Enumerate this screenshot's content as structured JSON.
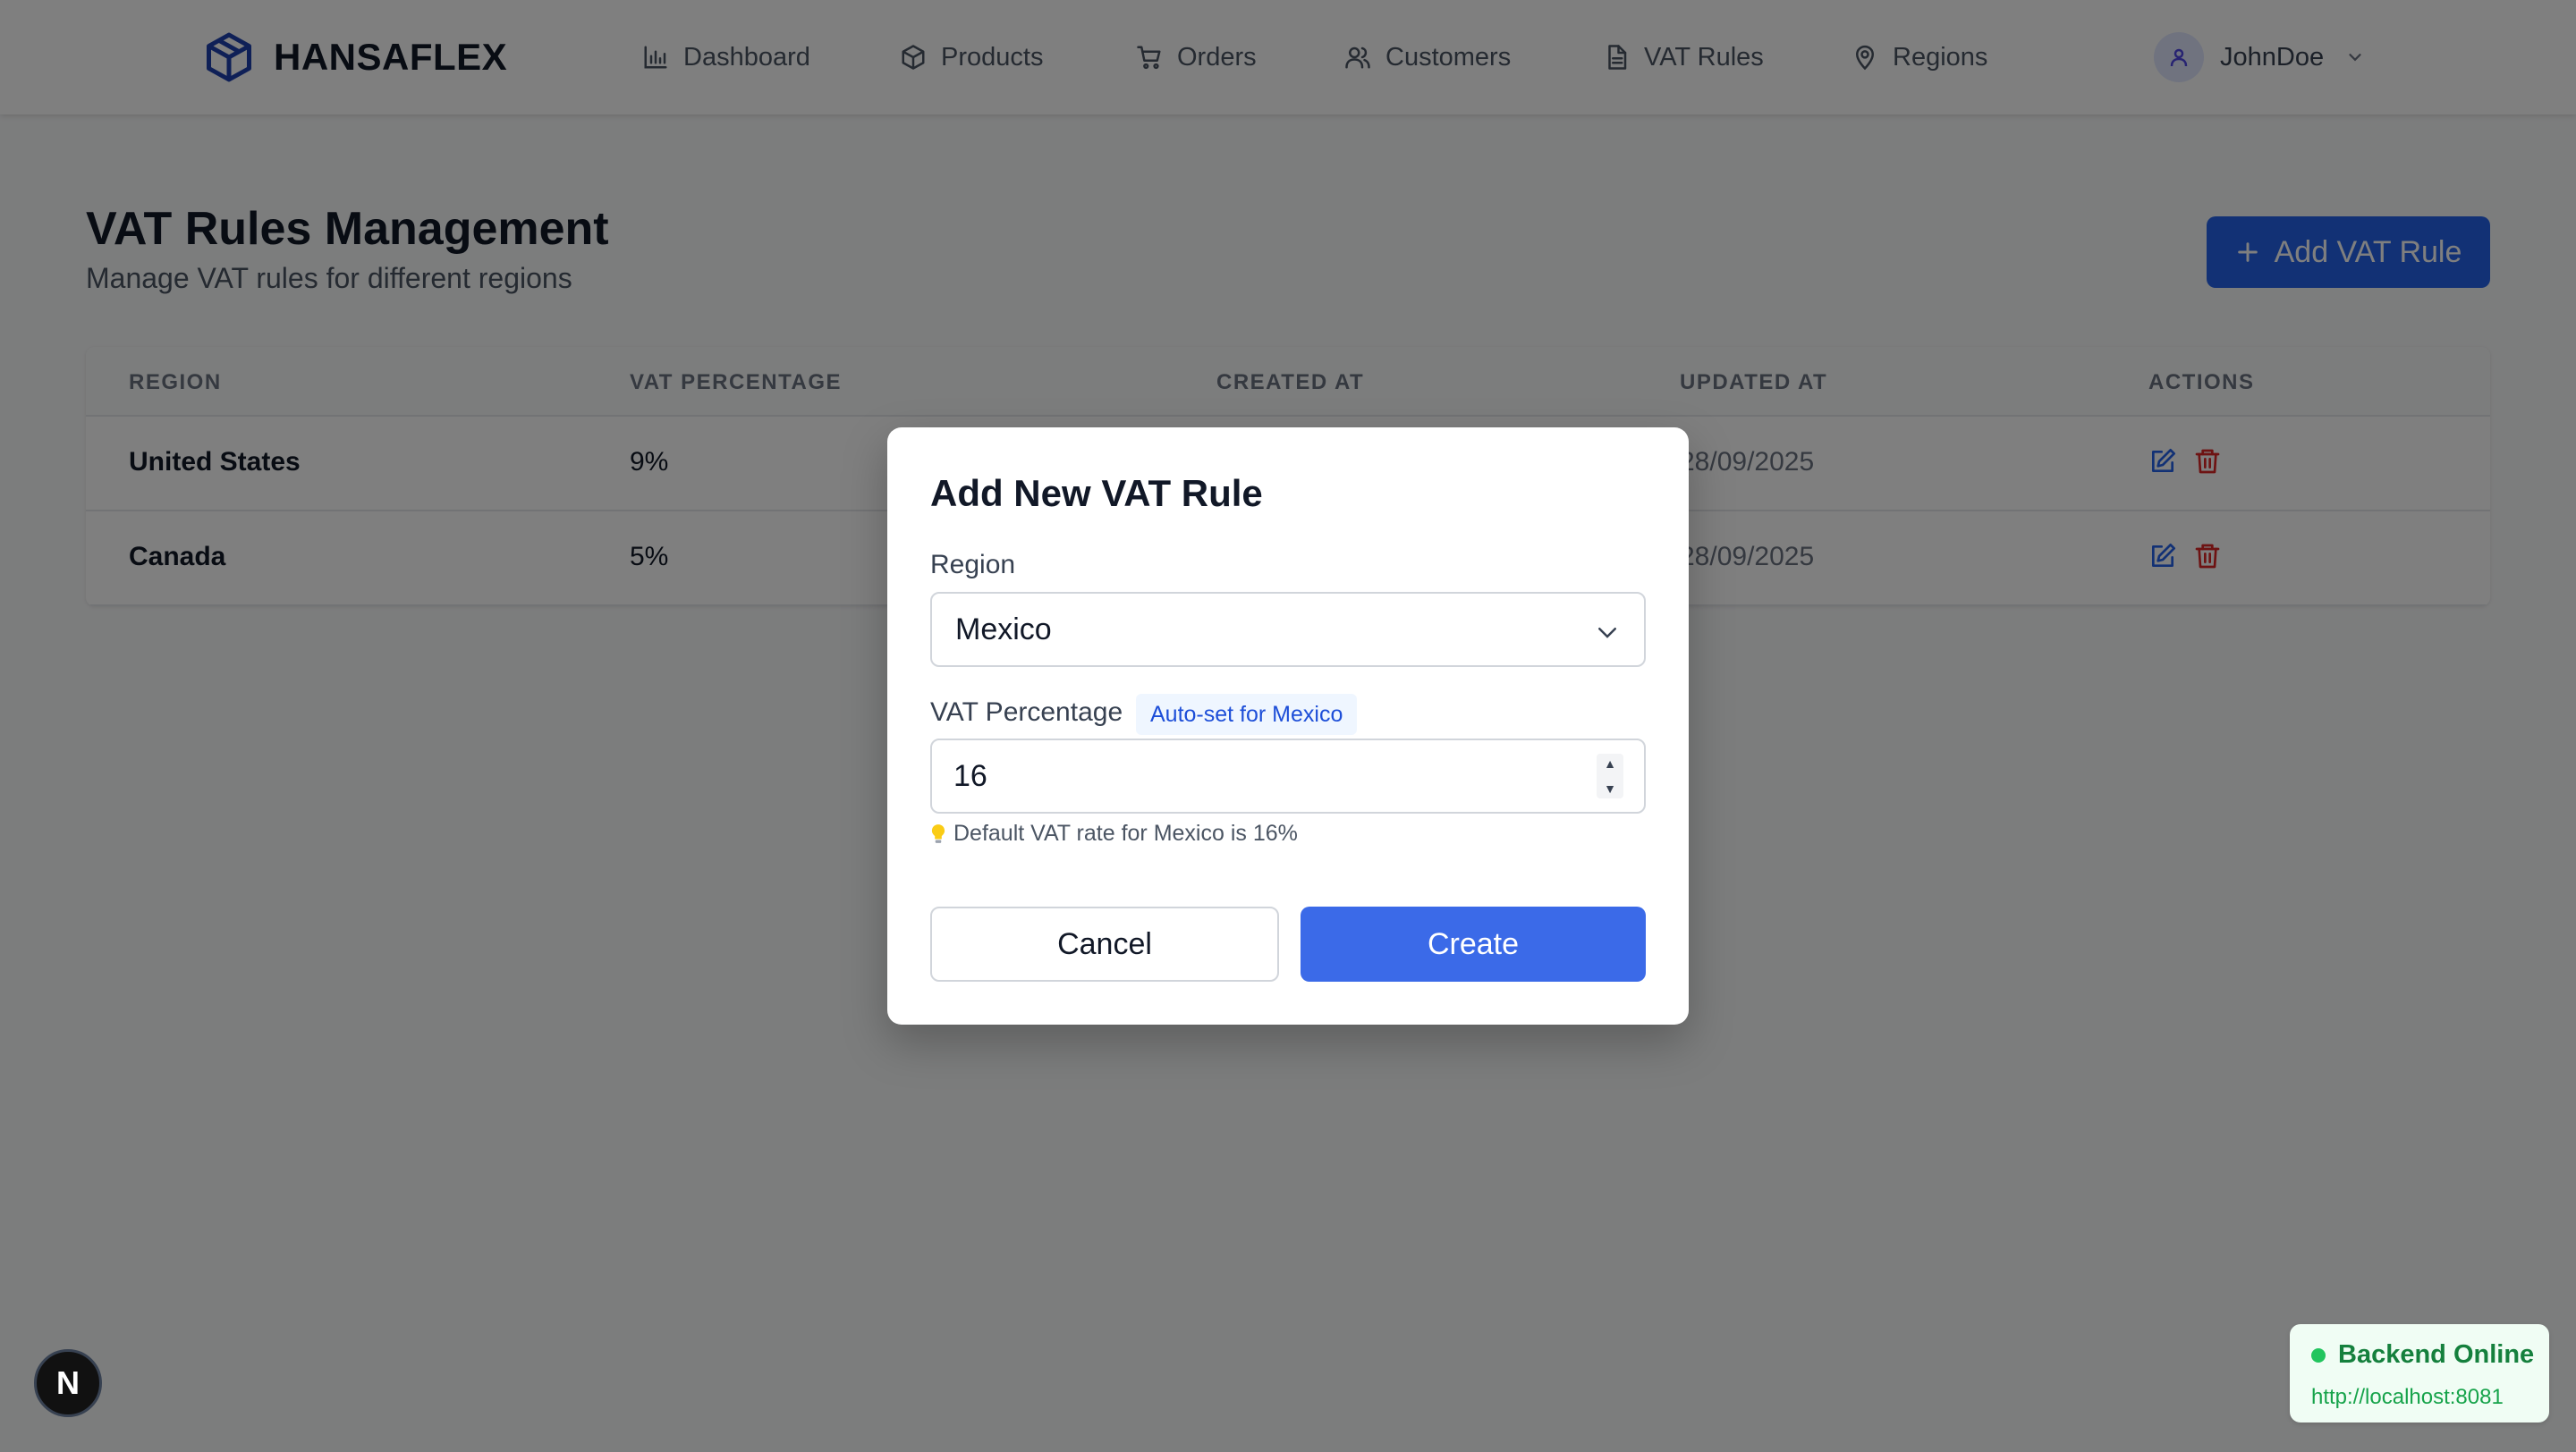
{
  "brand": {
    "name": "HANSAFLEX"
  },
  "nav": {
    "items": [
      {
        "label": "Dashboard",
        "icon": "bar-chart-icon"
      },
      {
        "label": "Products",
        "icon": "package-icon"
      },
      {
        "label": "Orders",
        "icon": "cart-icon"
      },
      {
        "label": "Customers",
        "icon": "users-icon"
      },
      {
        "label": "VAT Rules",
        "icon": "document-icon"
      },
      {
        "label": "Regions",
        "icon": "map-pin-icon"
      }
    ],
    "user": {
      "name": "JohnDoe"
    }
  },
  "page": {
    "title": "VAT Rules Management",
    "subtitle": "Manage VAT rules for different regions",
    "add_button": "Add VAT Rule"
  },
  "table": {
    "columns": [
      "Region",
      "VAT Percentage",
      "Created At",
      "Updated At",
      "Actions"
    ],
    "rows": [
      {
        "region": "United States",
        "vat": "9%",
        "updated": "28/09/2025"
      },
      {
        "region": "Canada",
        "vat": "5%",
        "updated": "28/09/2025"
      }
    ]
  },
  "modal": {
    "title": "Add New VAT Rule",
    "region_label": "Region",
    "region_value": "Mexico",
    "vat_label": "VAT Percentage",
    "auto_badge": "Auto-set for Mexico",
    "vat_value": "16",
    "hint": "Default VAT rate for Mexico is 16%",
    "cancel": "Cancel",
    "create": "Create"
  },
  "status": {
    "title": "Backend Online",
    "url": "http://localhost:8081"
  },
  "dev_badge": "N",
  "colors": {
    "primary": "#2563eb",
    "success": "#22c55e",
    "danger": "#dc2626"
  }
}
